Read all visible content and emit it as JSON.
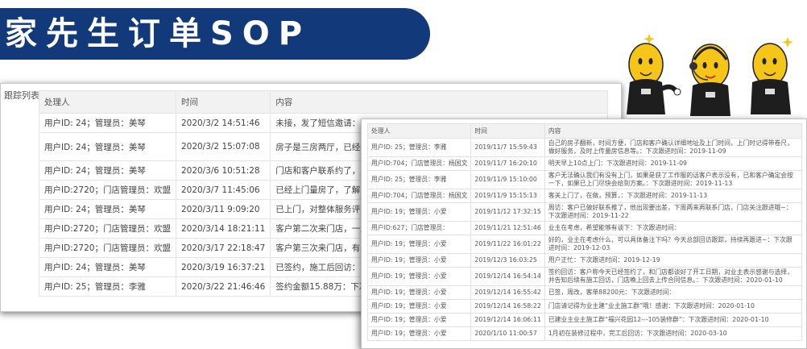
{
  "banner": {
    "title": "家先生订单SOP"
  },
  "left_panel": {
    "section_label": "跟踪列表",
    "headers": [
      "处理人",
      "时间",
      "内容"
    ],
    "rows": [
      {
        "user": "用户ID: 24；管理员：美琴",
        "time": "2020/3/2 14:51:46",
        "content": "未接，发了短信邀请：下次跟进时间：2020-03-03"
      },
      {
        "user": "用户ID: 24；管理员：美琴",
        "time": "2020/3/2 15:07:08",
        "content": "房子是三房两厅，已经装了十几年，墙面以进去：下次跟进时间：2020-03-06"
      },
      {
        "user": "用户ID: 24；管理员：美琴",
        "time": "2020/3/6 10:51:28",
        "content": "门店和客户联系约了，周末有空，明天"
      },
      {
        "user": "用户ID:2720；门店管理员：欢盟",
        "time": "2020/3/7 11:45:06",
        "content": "已经上门量房了，了解了一下初步需求"
      },
      {
        "user": "用户ID: 24；管理员：美琴",
        "time": "2020/3/11 9:09:20",
        "content": "已上门，对整体服务评9分，方案还没有"
      },
      {
        "user": "用户ID:2720；门店管理员：欢盟",
        "time": "2020/3/14 18:21:11",
        "content": "客户第二次来门店，一起沟通了方案和"
      },
      {
        "user": "用户ID:2720；门店管理员：欢盟",
        "time": "2020/3/17 22:18:47",
        "content": "客户第三次来门店，有些效果图设计的"
      },
      {
        "user": "用户ID: 24；管理员：美琴",
        "time": "2020/3/19 16:37:21",
        "content": "已签约，施工后回访：下次跟进时间"
      },
      {
        "user": "用户ID: 25；管理员：李雅",
        "time": "2020/3/22 21:46:46",
        "content": "签约金额15.88万：下次跟进时间"
      }
    ]
  },
  "right_panel": {
    "headers": [
      "处理人",
      "时间",
      "内容"
    ],
    "rows": [
      {
        "user": "用户ID: 25；管理员：李雅",
        "time": "2019/11/7 15:59:43",
        "content": "自己的房子翻新，时间方便，门店和客户确认详细地址及上门时间，上门时记得带卷尺，做好服务，及时上传量房信息等。：下次跟进时间：2019-11-09"
      },
      {
        "user": "用户ID:704；门店管理员：杨国文",
        "time": "2019/11/7 16:20:10",
        "content": "明天早上10点上门：下次跟进时间：2019-11-09"
      },
      {
        "user": "用户ID: 25；管理员：李雅",
        "time": "2019/11/9 15:10:00",
        "content": "客户无法确认我们有没有上门，如果是获了工作服的话客户表示没有，已和客户确定会按一下，如果已上门尽快会给到方案。：下次跟进时间：2019-11-13"
      },
      {
        "user": "用户ID:704；门店管理员：杨国文",
        "time": "2019/11/9 15:15:13",
        "content": "客关上门了，在做，预算，：下次跟进时间：2019-11-13"
      },
      {
        "user": "用户ID: 19；管理员：小爱",
        "time": "2019/11/12 17:32:15",
        "content": "周访：客户已做好联系推了，他出现要出差，下周两来再联系门店，门店关注跟进哦~：下次跟进时间：2019-11-22"
      },
      {
        "user": "用户ID:627；门店管理员：",
        "time": "2019/11/21 12:51:46",
        "content": "业主在考虑，希望能够有谈下：下次跟进时间："
      },
      {
        "user": "用户ID: 19；管理员：小爱",
        "time": "2019/11/22 16:01:22",
        "content": "好的，业主在考虑什么，可以具体备注下吗？今天总部回访跟踪，持续再跟进~：下次跟进时间：2019-12-03"
      },
      {
        "user": "用户ID: 19；管理员：小爱",
        "time": "2019/12/3 16:03:25",
        "content": "用户正忙：下次跟进时间：2019-12-19"
      },
      {
        "user": "用户ID: 19；管理员：小爱",
        "time": "2019/12/14 16:54:14",
        "content": "签约回访：客户称今天已经签约了，和门店都谈好了开工日期，对业主表示感谢与选择，并告知后续有施工回访，门店晚上回去上传合同信息。：下次跟进时间：2020-01-10"
      },
      {
        "user": "用户ID: 19；管理员：小爱",
        "time": "2019/12/14 16:55:42",
        "content": "已签，周改，客单88200元：下次跟进时间："
      },
      {
        "user": "用户ID: 19；管理员：小爱",
        "time": "2019/12/14 16:58:22",
        "content": "门店请记得为业主建“业主施工群”哦！感谢：下次跟进时间：2020-01-10"
      },
      {
        "user": "用户ID: 19；管理员：小爱",
        "time": "2019/12/14 16:06:11",
        "content": "已建业主业主施工群“福兴花园12---105装修群”：下次跟进时间：2020-01-10"
      },
      {
        "user": "用户ID: 19；管理员：小爱",
        "time": "2020/1/10 11:00:57",
        "content": "1月初在装修过程中，完工后回访：下次跟进时间：2020-03-10"
      }
    ]
  },
  "colors": {
    "banner_bg": "#123a7a",
    "banner_text": "#ffffff",
    "header_bg": "#f2f2f2",
    "mascot_yellow": "#f5c518",
    "mascot_suit": "#1e1e1e"
  },
  "icons": {
    "mascots": "three-yellow-mascots-in-black-suits-icon"
  }
}
